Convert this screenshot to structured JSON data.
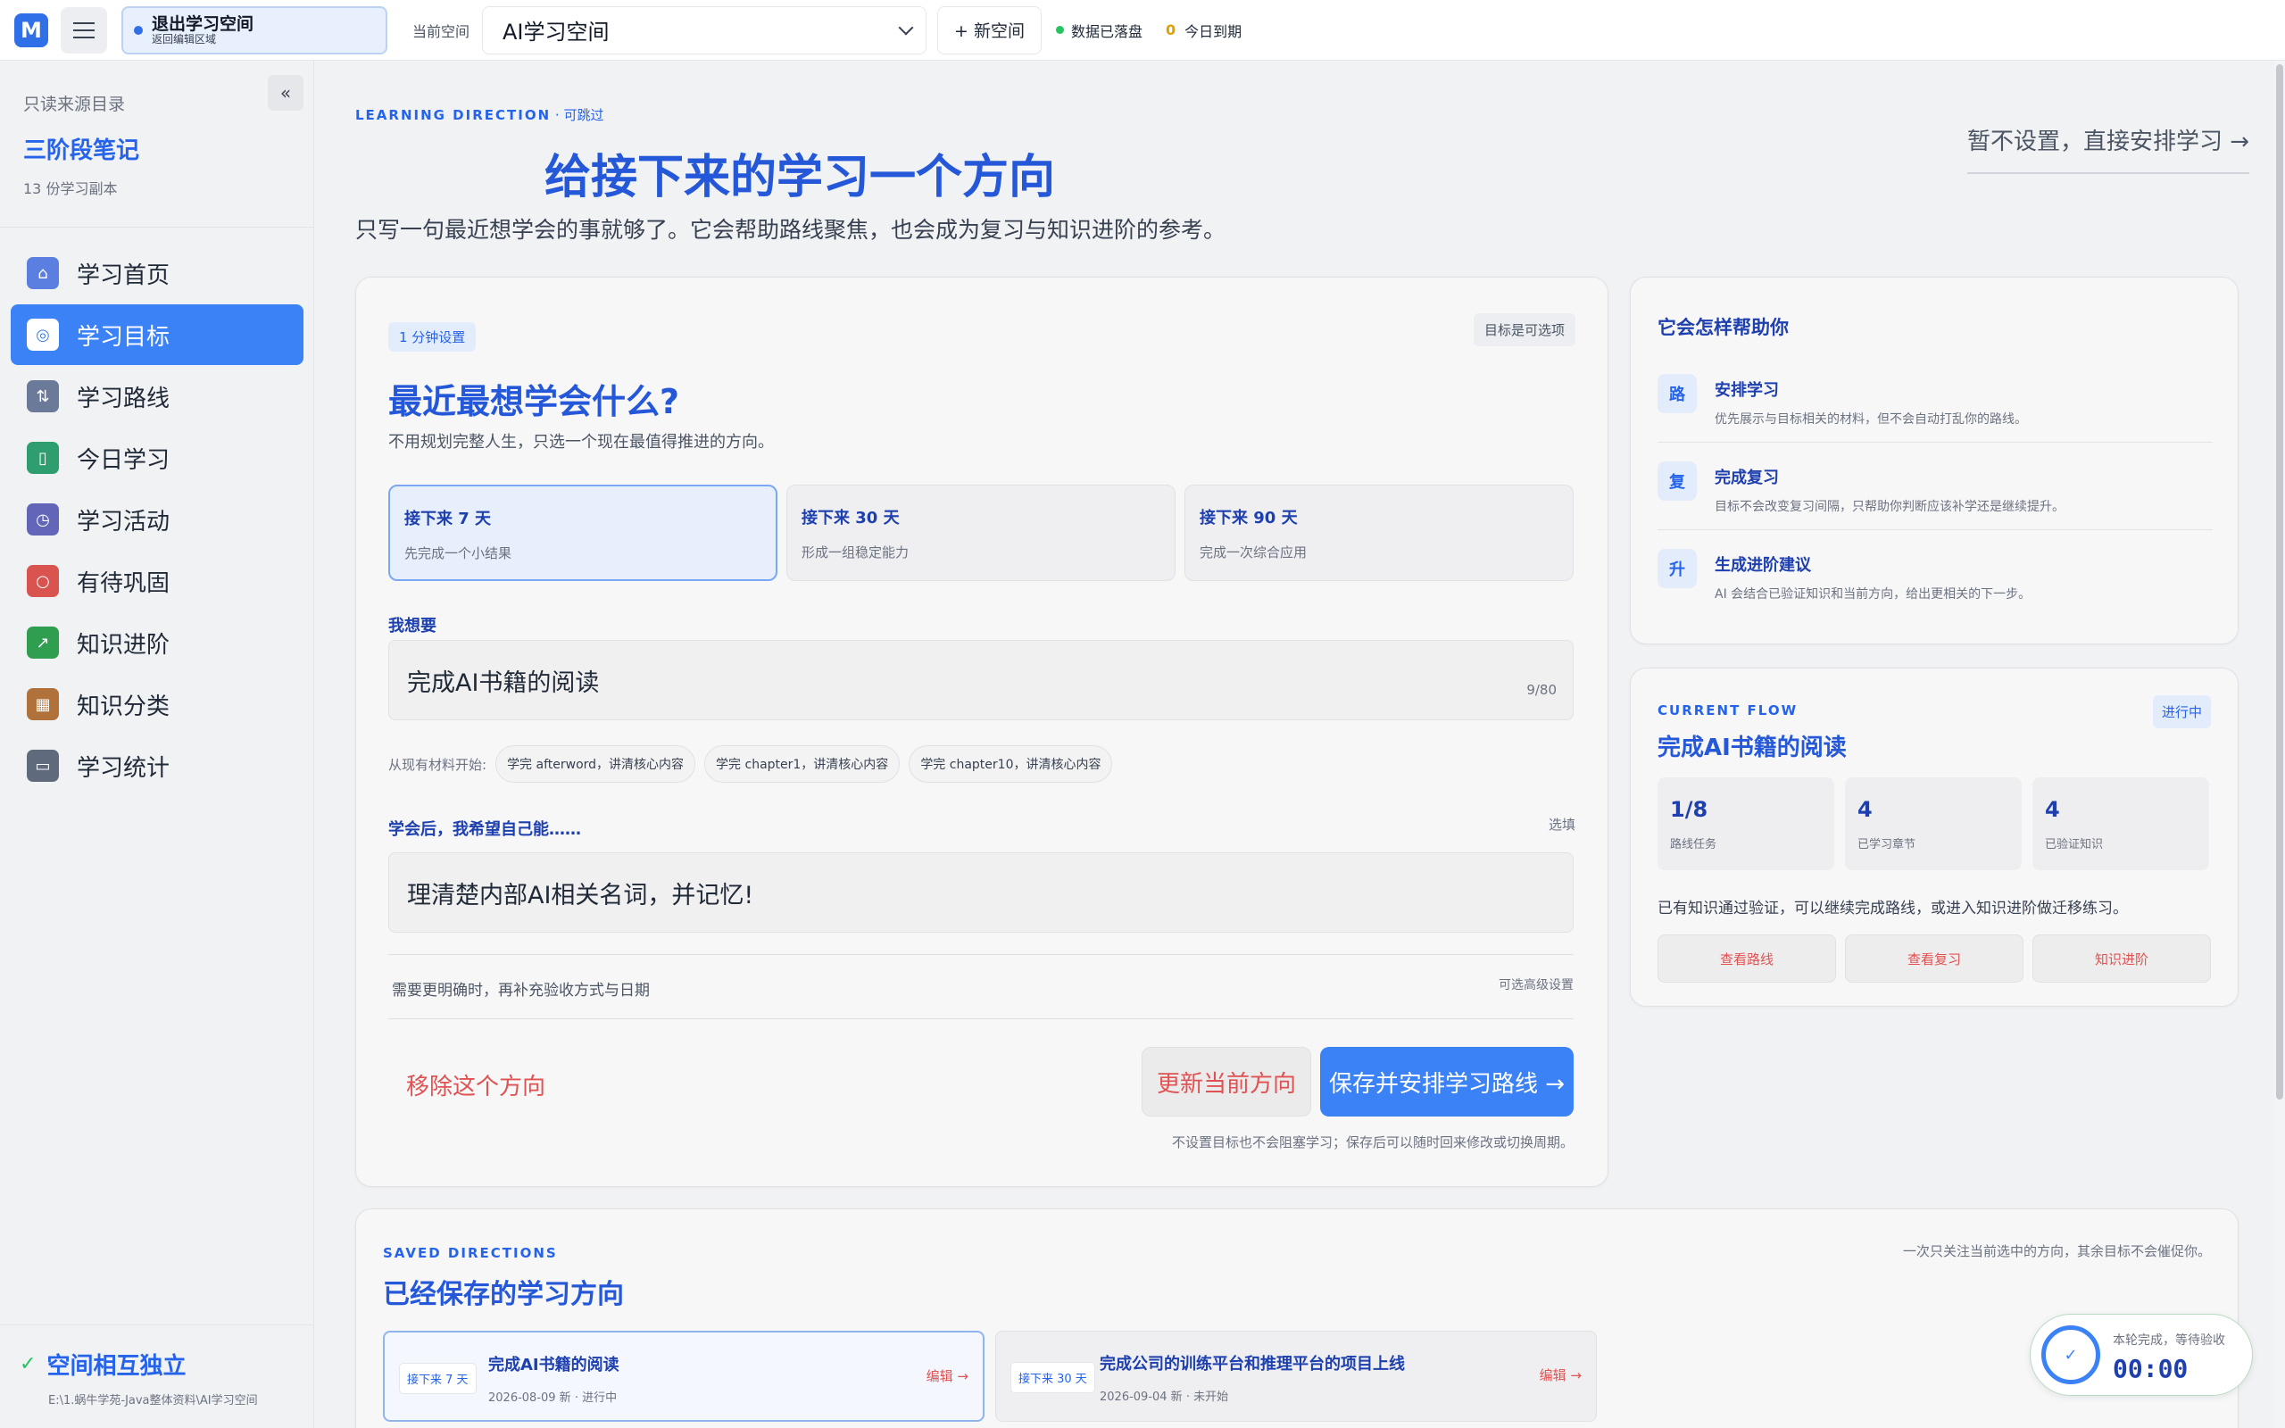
{
  "topbar": {
    "logo": "M",
    "exit_title": "退出学习空间",
    "exit_sub": "返回编辑区域",
    "current_space_label": "当前空间",
    "current_space": "AI学习空间",
    "new_space": "+ 新空间",
    "status_saved": "数据已落盘",
    "due_count": "0",
    "due_label": "今日到期"
  },
  "sidebar": {
    "collapse": "«",
    "source_label": "只读来源目录",
    "source_title": "三阶段笔记",
    "source_count": "13 份学习副本",
    "items": [
      {
        "label": "学习首页",
        "icon": "home-icon",
        "color": "#5b7fe0"
      },
      {
        "label": "学习目标",
        "icon": "target-icon",
        "color": "#ffffff"
      },
      {
        "label": "学习路线",
        "icon": "route-icon",
        "color": "#6b7a99"
      },
      {
        "label": "今日学习",
        "icon": "book-icon",
        "color": "#2f9e6e"
      },
      {
        "label": "学习活动",
        "icon": "clock-icon",
        "color": "#6366b8"
      },
      {
        "label": "有待巩固",
        "icon": "search-icon",
        "color": "#d9534f"
      },
      {
        "label": "知识进阶",
        "icon": "chart-icon",
        "color": "#2f9e4e"
      },
      {
        "label": "知识分类",
        "icon": "grid-icon",
        "color": "#b0713a"
      },
      {
        "label": "学习统计",
        "icon": "folder-icon",
        "color": "#5f6b7d"
      }
    ],
    "footer_title": "空间相互独立",
    "footer_path": "E:\\1.蜗牛学苑-Java整体资料\\AI学习空间"
  },
  "hero": {
    "eyebrow": "LEARNING DIRECTION",
    "eyebrow_opt": " · 可跳过",
    "title": "给接下来的学习一个方向",
    "subtitle": "只写一句最近想学会的事就够了。它会帮助路线聚焦，也会成为复习与知识进阶的参考。",
    "skip": "暂不设置，直接安排学习 →"
  },
  "goal": {
    "badge_setup": "1 分钟设置",
    "badge_optional": "目标是可选项",
    "title": "最近最想学会什么?",
    "subtitle": "不用规划完整人生，只选一个现在最值得推进的方向。",
    "periods": [
      {
        "title": "接下来 7 天",
        "desc": "先完成一个小结果"
      },
      {
        "title": "接下来 30 天",
        "desc": "形成一组稳定能力"
      },
      {
        "title": "接下来 90 天",
        "desc": "完成一次综合应用"
      }
    ],
    "want_label": "我想要",
    "want_value": "完成AI书籍的阅读",
    "want_counter": "9/80",
    "chips_label": "从现有材料开始:",
    "chips": [
      "学完 afterword，讲清核心内容",
      "学完 chapter1，讲清核心内容",
      "学完 chapter10，讲清核心内容"
    ],
    "hope_label": "学会后，我希望自己能……",
    "hope_optional": "选填",
    "hope_value": "理清楚内部AI相关名词，并记忆!",
    "more_text": "需要更明确时，再补充验收方式与日期",
    "advanced": "可选高级设置",
    "remove": "移除这个方向",
    "update": "更新当前方向",
    "save": "保存并安排学习路线 →",
    "footnote": "不设置目标也不会阻塞学习；保存后可以随时回来修改或切换周期。"
  },
  "help": {
    "title": "它会怎样帮助你",
    "items": [
      {
        "icon": "路",
        "name": "安排学习",
        "desc": "优先展示与目标相关的材料，但不会自动打乱你的路线。"
      },
      {
        "icon": "复",
        "name": "完成复习",
        "desc": "目标不会改变复习间隔，只帮助你判断应该补学还是继续提升。"
      },
      {
        "icon": "升",
        "name": "生成进阶建议",
        "desc": "AI 会结合已验证知识和当前方向，给出更相关的下一步。"
      }
    ]
  },
  "flow": {
    "eyebrow": "CURRENT FLOW",
    "badge": "进行中",
    "title": "完成AI书籍的阅读",
    "stats": [
      {
        "num": "1/8",
        "label": "路线任务"
      },
      {
        "num": "4",
        "label": "已学习章节"
      },
      {
        "num": "4",
        "label": "已验证知识"
      }
    ],
    "desc": "已有知识通过验证，可以继续完成路线，或进入知识进阶做迁移练习。",
    "buttons": [
      "查看路线",
      "查看复习",
      "知识进阶"
    ]
  },
  "saved": {
    "eyebrow": "SAVED DIRECTIONS",
    "title": "已经保存的学习方向",
    "note": "一次只关注当前选中的方向，其余目标不会催促你。",
    "items": [
      {
        "tag": "接下来 7 天",
        "name": "完成AI书籍的阅读",
        "meta": "2026-08-09 新 · 进行中",
        "edit": "编辑 →"
      },
      {
        "tag": "接下来 30 天",
        "name": "完成公司的训练平台和推理平台的项目上线",
        "meta": "2026-09-04 新 · 未开始",
        "edit": "编辑 →"
      }
    ]
  },
  "timer": {
    "icon": "✓",
    "label": "本轮完成，等待验收",
    "time": "00:00"
  }
}
